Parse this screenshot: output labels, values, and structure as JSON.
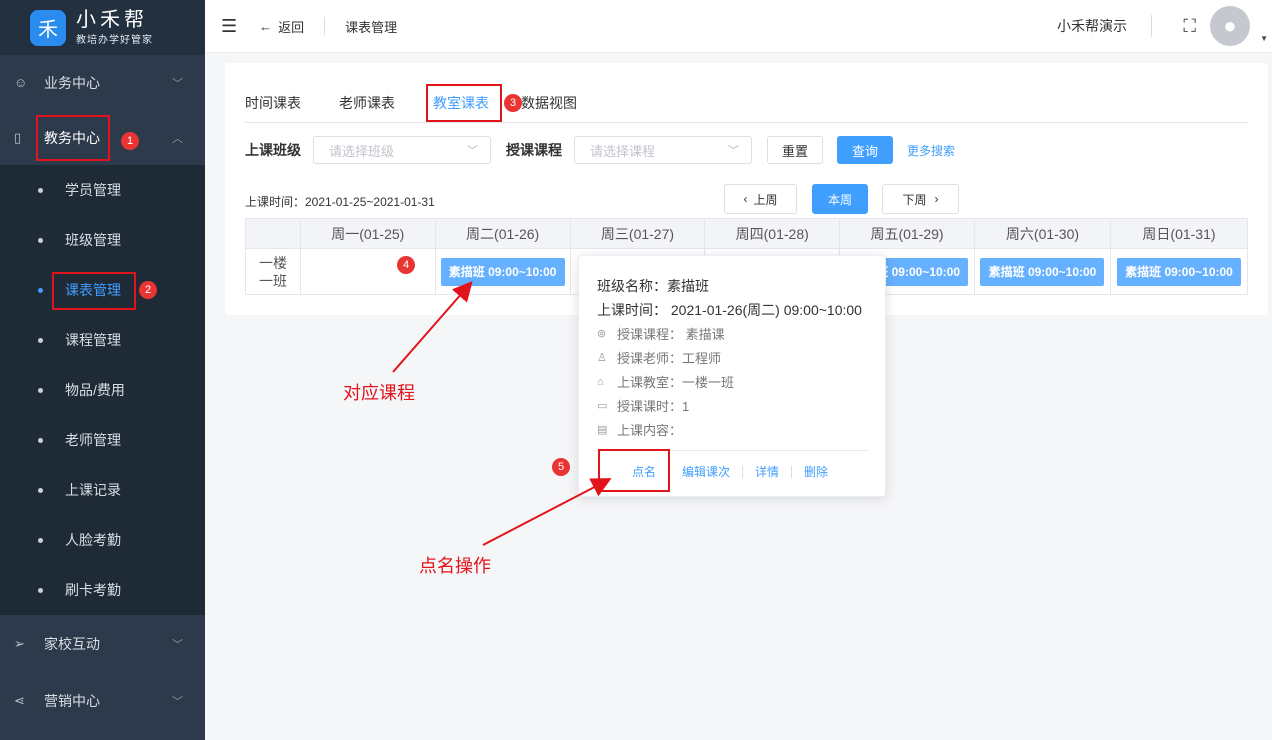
{
  "app": {
    "logo_glyph": "禾",
    "logo_title": "小禾帮",
    "logo_subtitle": "教培办学好管家"
  },
  "sidebar": {
    "groups": [
      {
        "label": "业务中心",
        "icon": "user-circle-icon"
      },
      {
        "label": "教务中心",
        "icon": "book-icon"
      },
      {
        "label": "家校互动",
        "icon": "paper-plane-icon"
      },
      {
        "label": "营销中心",
        "icon": "share-icon"
      }
    ],
    "subitems": [
      "学员管理",
      "班级管理",
      "课表管理",
      "课程管理",
      "物品/费用",
      "老师管理",
      "上课记录",
      "人脸考勤",
      "刷卡考勤"
    ]
  },
  "topbar": {
    "back_label": "返回",
    "page_title": "课表管理",
    "user_name": "小禾帮演示"
  },
  "tabs": [
    "时间课表",
    "老师课表",
    "教室课表",
    "数据视图"
  ],
  "filters": {
    "class_label": "上课班级",
    "class_placeholder": "请选择班级",
    "course_label": "授课课程",
    "course_placeholder": "请选择课程",
    "reset": "重置",
    "query": "查询",
    "more": "更多搜索"
  },
  "date_range": "上课时间：2021-01-25~2021-01-31",
  "week_nav": {
    "prev": "上周",
    "current": "本周",
    "next": "下周"
  },
  "schedule": {
    "days": [
      "周一(01-25)",
      "周二(01-26)",
      "周三(01-27)",
      "周四(01-28)",
      "周五(01-29)",
      "周六(01-30)",
      "周日(01-31)"
    ],
    "room_line1": "一楼",
    "room_line2": "一班",
    "chip_text": "素描班 09:00~10:00",
    "chip_partial_text": "班 09:00~10:00"
  },
  "popover": {
    "class_name": "班级名称：素描班",
    "time": "上课时间：  2021-01-26(周二) 09:00~10:00",
    "course": "授课课程：  素描课",
    "teacher": "授课老师：工程师",
    "room": "上课教室：一楼一班",
    "hours": "授课课时：1",
    "content": "上课内容：",
    "actions": [
      "点名",
      "编辑课次",
      "详情",
      "删除"
    ]
  },
  "annotations": {
    "badges": [
      "1",
      "2",
      "3",
      "4",
      "5"
    ],
    "label_course": "对应课程",
    "label_rollcall": "点名操作",
    "color": "#e2141b"
  }
}
